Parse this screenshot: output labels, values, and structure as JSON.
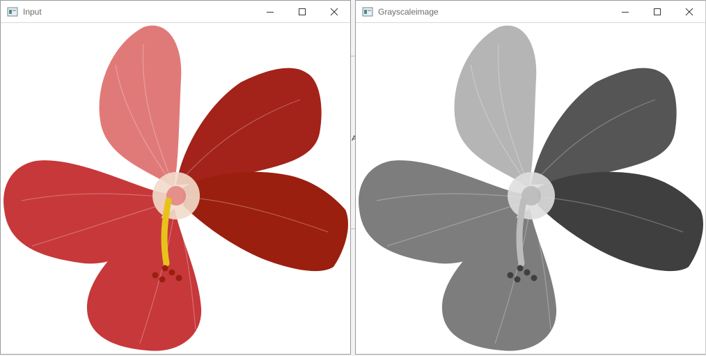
{
  "windows": [
    {
      "title": "Input",
      "icon": "opencv-window-icon",
      "image": "red-hibiscus-flower",
      "colors": {
        "petal_light": "#e07a78",
        "petal_mid": "#c7383a",
        "petal_dark": "#a3221a",
        "petal_deep": "#9a1f0e",
        "throat": "#f2dccb",
        "stamen": "#e8c21a"
      }
    },
    {
      "title": "Grayscaleimage",
      "icon": "opencv-window-icon",
      "image": "grayscale-hibiscus-flower",
      "colors": {
        "petal_light": "#b5b5b5",
        "petal_mid": "#7d7d7d",
        "petal_dark": "#555555",
        "petal_deep": "#3f3f3f",
        "throat": "#dedede",
        "stamen": "#bcbcbc"
      }
    }
  ],
  "controls": {
    "minimize": "minimize-icon",
    "maximize": "maximize-icon",
    "close": "close-icon"
  },
  "gap_text": "A"
}
